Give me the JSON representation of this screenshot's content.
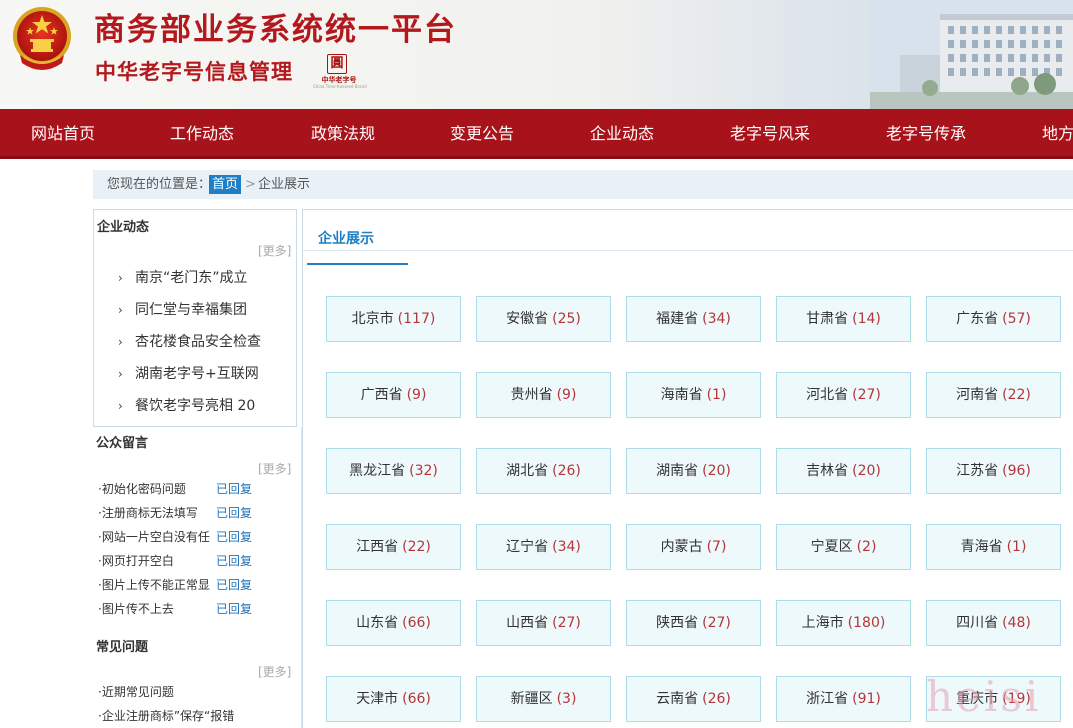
{
  "header": {
    "site_title": "商务部业务系统统一平台",
    "sub_title": "中华老字号信息管理",
    "logo_seal": "圓",
    "logo_cn": "中华老字号",
    "logo_en": "China Time-honored Brand"
  },
  "nav": {
    "items": [
      "网站首页",
      "工作动态",
      "政策法规",
      "变更公告",
      "企业动态",
      "老字号风采",
      "老字号传承",
      "地方"
    ]
  },
  "breadcrumb": {
    "label": "您现在的位置是：",
    "home": "首页",
    "separator": ">",
    "current": "企业展示"
  },
  "sidebar": {
    "news": {
      "title": "企业动态",
      "more": "[更多]",
      "items": [
        "南京“老门东”成立",
        "同仁堂与幸福集团",
        "杏花楼食品安全检查",
        "湖南老字号+互联网",
        "餐饮老字号亮相 20"
      ]
    },
    "messages": {
      "title": "公众留言",
      "more": "[更多]",
      "items": [
        {
          "q": "·初始化密码问题",
          "s": "已回复"
        },
        {
          "q": "·注册商标无法填写",
          "s": "已回复"
        },
        {
          "q": "·网站一片空白没有任",
          "s": "已回复"
        },
        {
          "q": "·网页打开空白",
          "s": "已回复"
        },
        {
          "q": "·图片上传不能正常显",
          "s": "已回复"
        },
        {
          "q": "·图片传不上去",
          "s": "已回复"
        }
      ]
    },
    "faq": {
      "title": "常见问题",
      "more": "[更多]",
      "items": [
        "·近期常见问题",
        "·企业注册商标”保存“报错"
      ]
    }
  },
  "main": {
    "tab_title": "企业展示",
    "provinces": [
      {
        "name": "北京市",
        "count": "(117)"
      },
      {
        "name": "安徽省",
        "count": "(25)"
      },
      {
        "name": "福建省",
        "count": "(34)"
      },
      {
        "name": "甘肃省",
        "count": "(14)"
      },
      {
        "name": "广东省",
        "count": "(57)"
      },
      {
        "name": "广西省",
        "count": "(9)"
      },
      {
        "name": "贵州省",
        "count": "(9)"
      },
      {
        "name": "海南省",
        "count": "(1)"
      },
      {
        "name": "河北省",
        "count": "(27)"
      },
      {
        "name": "河南省",
        "count": "(22)"
      },
      {
        "name": "黑龙江省",
        "count": "(32)"
      },
      {
        "name": "湖北省",
        "count": "(26)"
      },
      {
        "name": "湖南省",
        "count": "(20)"
      },
      {
        "name": "吉林省",
        "count": "(20)"
      },
      {
        "name": "江苏省",
        "count": "(96)"
      },
      {
        "name": "江西省",
        "count": "(22)"
      },
      {
        "name": "辽宁省",
        "count": "(34)"
      },
      {
        "name": "内蒙古",
        "count": "(7)"
      },
      {
        "name": "宁夏区",
        "count": "(2)"
      },
      {
        "name": "青海省",
        "count": "(1)"
      },
      {
        "name": "山东省",
        "count": "(66)"
      },
      {
        "name": "山西省",
        "count": "(27)"
      },
      {
        "name": "陕西省",
        "count": "(27)"
      },
      {
        "name": "上海市",
        "count": "(180)"
      },
      {
        "name": "四川省",
        "count": "(48)"
      },
      {
        "name": "天津市",
        "count": "(66)"
      },
      {
        "name": "新疆区",
        "count": "(3)"
      },
      {
        "name": "云南省",
        "count": "(26)"
      },
      {
        "name": "浙江省",
        "count": "(91)"
      },
      {
        "name": "重庆市",
        "count": "(19)"
      }
    ]
  },
  "watermark": "heisi",
  "colors": {
    "brand_red": "#b3181d",
    "nav_red": "#a8121a",
    "link_blue": "#1e7fc4",
    "count_red": "#b3363a",
    "tile_bg": "#eef9fc",
    "tile_border": "#aedce8"
  }
}
